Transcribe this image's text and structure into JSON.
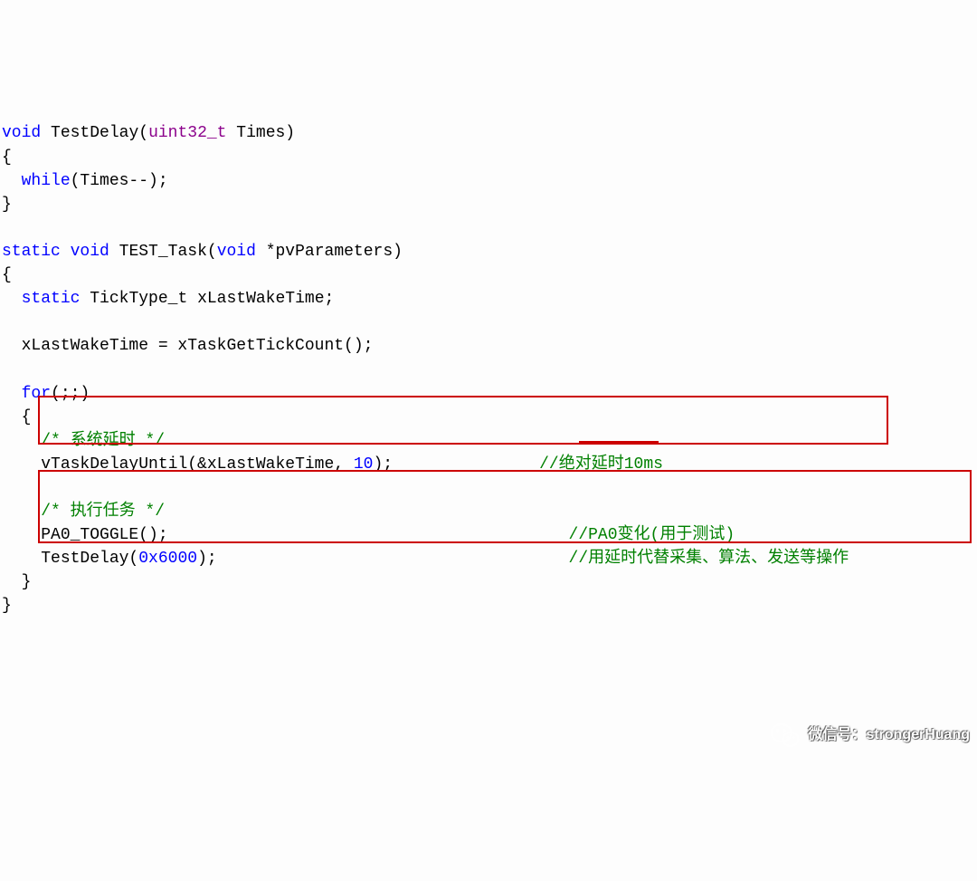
{
  "code": {
    "l1": {
      "kw1": "void",
      "fn": "TestDelay",
      "p": "(",
      "type": "uint32_t",
      "param": " Times)"
    },
    "l2": "{",
    "l3": {
      "kw": "while",
      "rest": "(Times--);"
    },
    "l4": "}",
    "l5": "",
    "l6": {
      "kw1": "static",
      "kw2": "void",
      "fn": "TEST_Task",
      "p": "(",
      "kw3": "void",
      "param": " *pvParameters)"
    },
    "l7": "{",
    "l8": {
      "kw": "static",
      "type": "TickType_t",
      "var": " xLastWakeTime;"
    },
    "l9": "",
    "l10": "  xLastWakeTime = xTaskGetTickCount();",
    "l11": "",
    "l12": {
      "kw": "for",
      "rest": "(;;)"
    },
    "l13": "  {",
    "l14": {
      "comment": "/* 系统延时 */"
    },
    "l15": {
      "call": "vTaskDelayUntil(&xLastWakeTime, ",
      "num": "10",
      "end": ");",
      "comment": "//绝对延时10ms"
    },
    "l16": "",
    "l17": {
      "comment": "/* 执行任务 */"
    },
    "l18": {
      "call": "PA0_TOGGLE();",
      "comment": "//PA0变化(用于测试)"
    },
    "l19": {
      "call": "TestDelay(",
      "num": "0x6000",
      "end": ");",
      "comment": "//用延时代替采集、算法、发送等操作"
    },
    "l20": "  }",
    "l21": "}"
  },
  "watermark": {
    "text": "微信号：strongerHuang"
  }
}
